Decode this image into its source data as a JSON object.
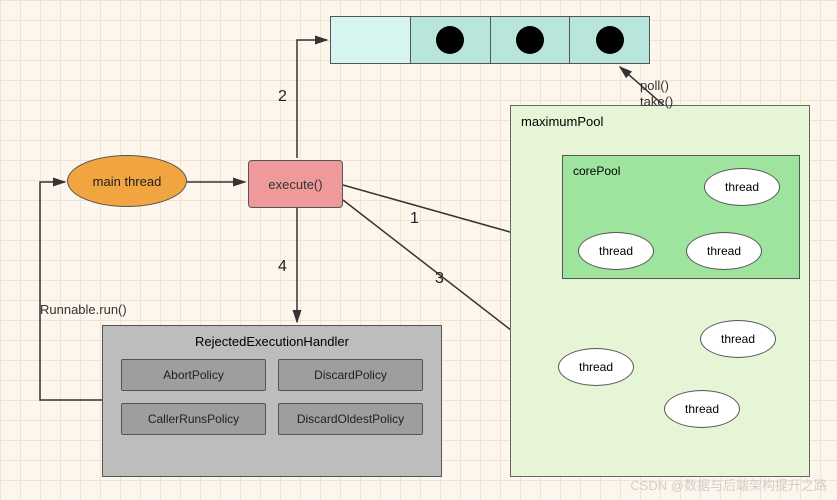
{
  "nodes": {
    "main_thread": "main thread",
    "execute": "execute()",
    "maximum_pool": "maximumPool",
    "core_pool": "corePool",
    "thread": "thread",
    "rejected_handler_title": "RejectedExecutionHandler"
  },
  "policies": {
    "abort": "AbortPolicy",
    "discard": "DiscardPolicy",
    "caller_runs": "CallerRunsPolicy",
    "discard_oldest": "DiscardOldestPolicy"
  },
  "labels": {
    "runnable_run": "Runnable.run()",
    "poll": "poll()",
    "take": "take()"
  },
  "arrows": {
    "n1": "1",
    "n2": "2",
    "n3": "3",
    "n4": "4"
  },
  "watermark": "CSDN @数据与后端架构提升之路"
}
